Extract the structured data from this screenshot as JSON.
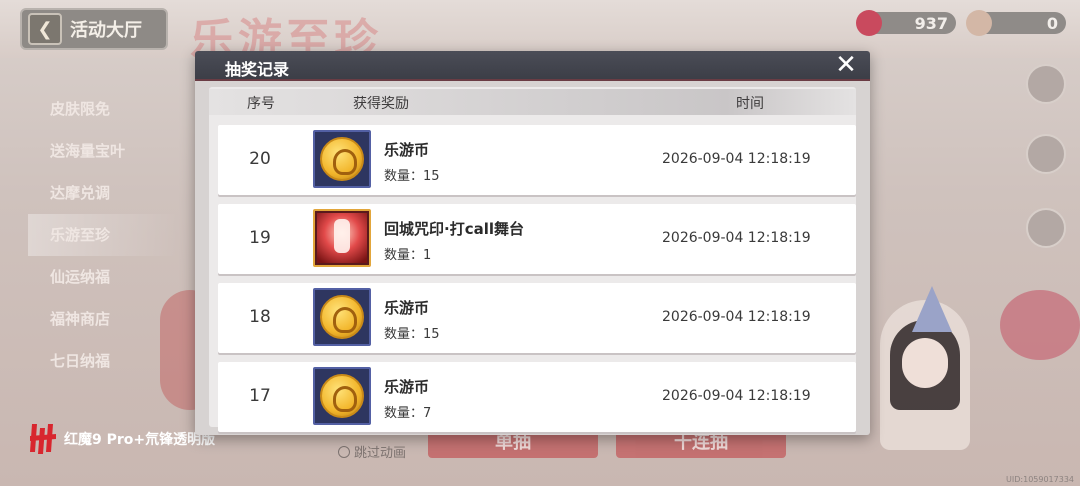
{
  "background": {
    "hall_label": "活动大厅",
    "banner_title": "乐游至珍",
    "currency": [
      {
        "name": "diamond",
        "value": "937"
      },
      {
        "name": "ticket",
        "value": "0"
      }
    ],
    "side_nav": [
      "皮肤限免",
      "送海量宝叶",
      "达摩兑调",
      "乐游至珍",
      "仙运纳福",
      "福神商店",
      "七日纳福"
    ],
    "active_side_item": "乐游至珍",
    "bottom_buttons": [
      "单抽",
      "十连抽"
    ],
    "skip_label": "跳过动画",
    "uid": "UID:1059017334"
  },
  "watermark": {
    "text": "红魔9 Pro+氘锋透明版"
  },
  "dialog": {
    "title": "抽奖记录",
    "close_icon": "close-icon",
    "columns": {
      "index": "序号",
      "reward": "获得奖励",
      "time": "时间"
    },
    "records": [
      {
        "index": "20",
        "name": "乐游币",
        "qty": "数量：15",
        "time": "2026-09-04 12:18:19",
        "icon": "coin-icon"
      },
      {
        "index": "19",
        "name": "回城咒印·打call舞台",
        "qty": "数量：1",
        "time": "2026-09-04 12:18:19",
        "icon": "stage-effect-icon"
      },
      {
        "index": "18",
        "name": "乐游币",
        "qty": "数量：15",
        "time": "2026-09-04 12:18:19",
        "icon": "coin-icon"
      },
      {
        "index": "17",
        "name": "乐游币",
        "qty": "数量：7",
        "time": "2026-09-04 12:18:19",
        "icon": "coin-icon"
      }
    ]
  }
}
